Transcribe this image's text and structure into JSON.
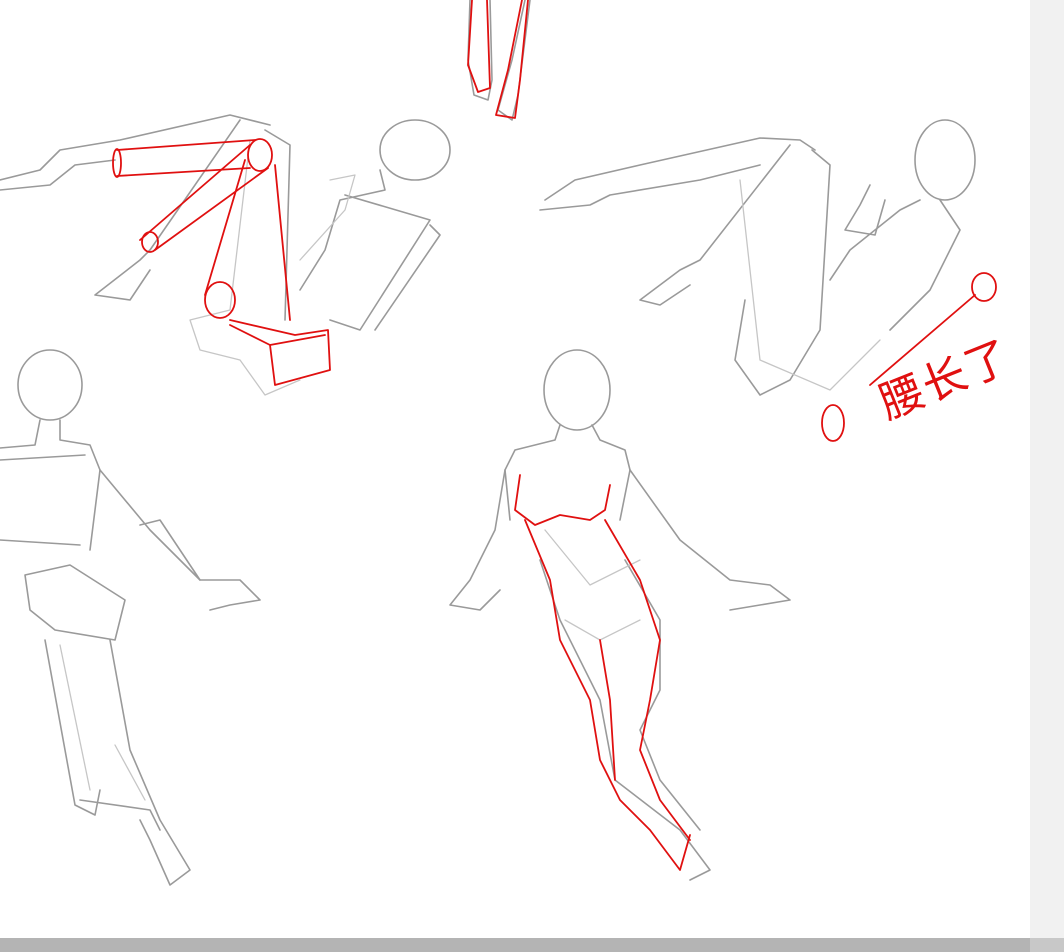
{
  "annotation": {
    "text": "腰长了",
    "color": "#e01010"
  },
  "colors": {
    "sketch_line": "#9a9a9a",
    "correction_line": "#e01010",
    "canvas": "#ffffff",
    "scrollbar": "#c8c8c8"
  }
}
